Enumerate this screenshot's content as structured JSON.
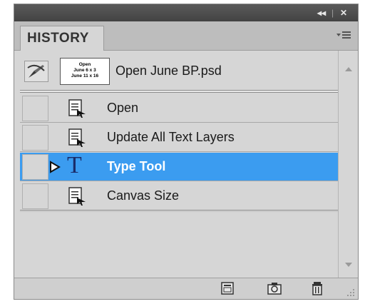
{
  "panel": {
    "tab_label": "HISTORY",
    "collapse_glyph": "◂◂",
    "close_glyph": "✕",
    "separator_glyph": "|"
  },
  "snapshot": {
    "label": "Open June BP.psd",
    "thumbnail_lines": [
      "Open",
      "June 6 x 3",
      "June 11 x 16"
    ]
  },
  "history_items": [
    {
      "label": "Open",
      "icon": "history-state-icon",
      "selected": false
    },
    {
      "label": "Update All Text Layers",
      "icon": "history-state-icon",
      "selected": false
    },
    {
      "label": "Type Tool",
      "icon": "type-tool-icon",
      "selected": true
    },
    {
      "label": "Canvas Size",
      "icon": "history-state-icon",
      "selected": false
    }
  ],
  "type_tool_glyph": "T",
  "colors": {
    "selection": "#3b9cf0",
    "panel_bg": "#d6d6d6",
    "titlebar": "#4d4d4d"
  }
}
